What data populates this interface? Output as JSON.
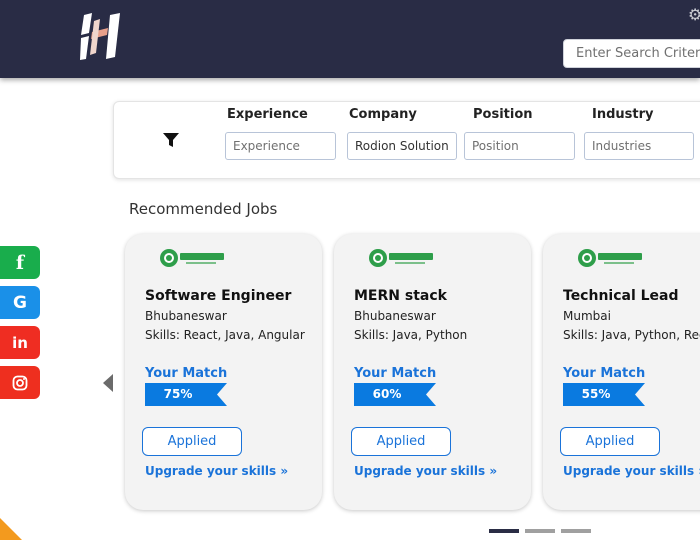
{
  "header": {
    "search_placeholder": "Enter Search Criteria",
    "logo_icon": "brand-logo-icon",
    "settings_icon": "gear-icon",
    "colors": {
      "background": "#292c45"
    }
  },
  "filters": {
    "experience": {
      "label": "Experience",
      "placeholder": "Experience",
      "value": ""
    },
    "company": {
      "label": "Company",
      "placeholder": "Company",
      "value": "Rodion Solutions"
    },
    "position": {
      "label": "Position",
      "placeholder": "Position",
      "value": ""
    },
    "industry": {
      "label": "Industry",
      "placeholder": "Industries",
      "value": ""
    },
    "icon": "funnel-icon"
  },
  "section_title": "Recommended Jobs",
  "social": [
    {
      "label": "f",
      "icon": "facebook-icon",
      "color": "#19ad4c"
    },
    {
      "label": "G",
      "icon": "google-icon",
      "color": "#1a90e8"
    },
    {
      "label": "in",
      "icon": "linkedin-icon",
      "color": "#ef2d22"
    },
    {
      "label": "",
      "icon": "instagram-icon",
      "color": "#ee2f1f"
    }
  ],
  "jobs": [
    {
      "title": "Software Engineer",
      "location": "Bhubaneswar",
      "skills": "Skills: React, Java, Angular",
      "match_label": "Your Match",
      "match": "75%",
      "match_value": 75,
      "button": "Applied",
      "upgrade": "Upgrade your skills »"
    },
    {
      "title": "MERN stack",
      "location": "Bhubaneswar",
      "skills": "Skills: Java, Python",
      "match_label": "Your Match",
      "match": "60%",
      "match_value": 60,
      "button": "Applied",
      "upgrade": "Upgrade your skills »"
    },
    {
      "title": "Technical Lead",
      "location": "Mumbai",
      "skills": "Skills: Java, Python, Redis",
      "match_label": "Your Match",
      "match": "55%",
      "match_value": 55,
      "button": "Applied",
      "upgrade": "Upgrade your skills »"
    }
  ],
  "carousel": {
    "pages": 3,
    "active_page": 1
  },
  "colors": {
    "accent": "#1a73d9",
    "card_bg": "#f3f3f3",
    "dot_active": "#2a2d45",
    "dot_inactive": "#a0a0a0"
  }
}
